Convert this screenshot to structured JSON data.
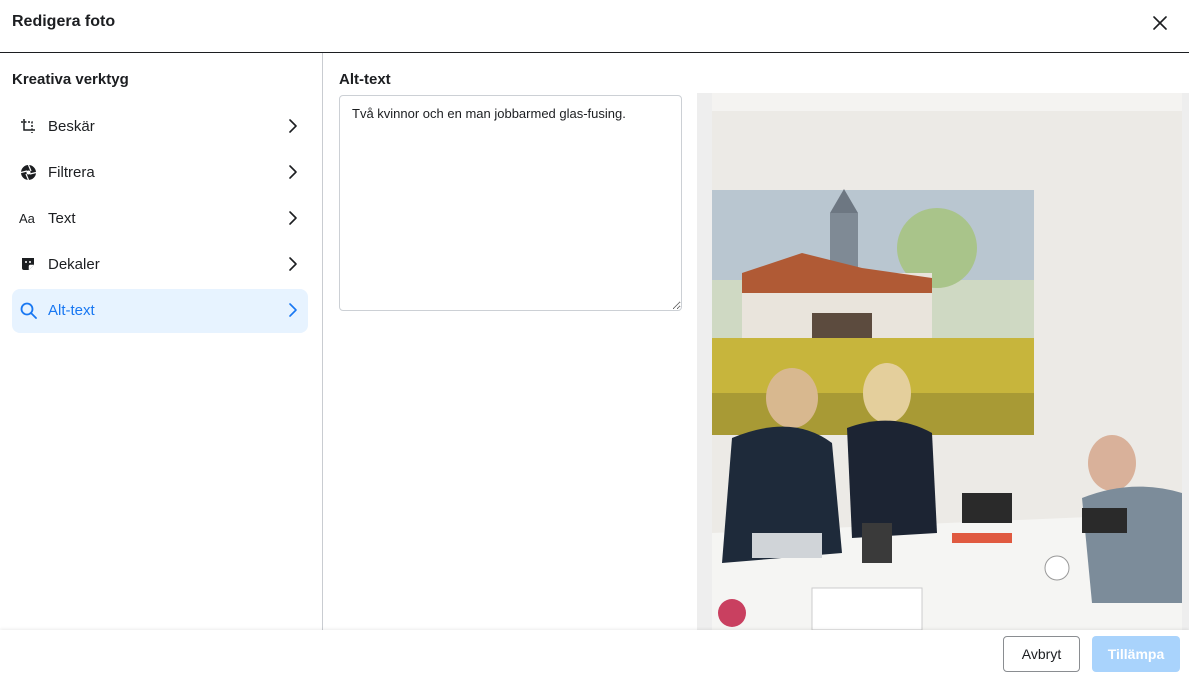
{
  "header": {
    "title": "Redigera foto"
  },
  "sidebar": {
    "title": "Kreativa verktyg",
    "items": [
      {
        "label": "Beskär",
        "icon": "crop-icon",
        "active": false
      },
      {
        "label": "Filtrera",
        "icon": "filter-aperture-icon",
        "active": false
      },
      {
        "label": "Text",
        "icon": "text-aa-icon",
        "active": false
      },
      {
        "label": "Dekaler",
        "icon": "sticker-icon",
        "active": false
      },
      {
        "label": "Alt-text",
        "icon": "search-icon",
        "active": true
      }
    ]
  },
  "main": {
    "title": "Alt-text",
    "alt_text_value": "Två kvinnor och en man jobbarmed glas-fusing."
  },
  "footer": {
    "cancel_label": "Avbryt",
    "apply_label": "Tillämpa"
  },
  "colors": {
    "accent": "#1877f2",
    "active_bg": "#e7f3ff",
    "apply_disabled": "#a9d3fc"
  }
}
